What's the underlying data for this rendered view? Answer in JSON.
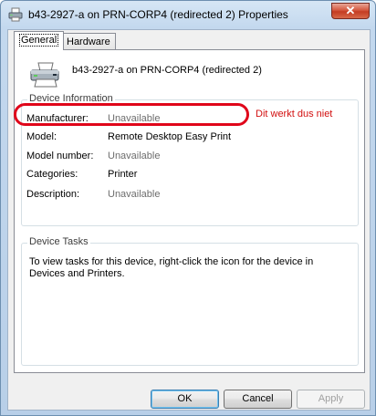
{
  "window": {
    "title": "b43-2927-a on PRN-CORP4 (redirected 2) Properties",
    "close_label": "✕"
  },
  "tabs": [
    {
      "label": "General",
      "active": true
    },
    {
      "label": "Hardware",
      "active": false
    }
  ],
  "device": {
    "name": "b43-2927-a on PRN-CORP4 (redirected 2)",
    "icon": "printer-icon"
  },
  "device_information": {
    "legend": "Device Information",
    "rows": [
      {
        "label": "Manufacturer:",
        "value": "Unavailable",
        "unavailable": true
      },
      {
        "label": "Model:",
        "value": "Remote Desktop Easy Print",
        "unavailable": false
      },
      {
        "label": "Model number:",
        "value": "Unavailable",
        "unavailable": true
      },
      {
        "label": "Categories:",
        "value": "Printer",
        "unavailable": false
      },
      {
        "label": "Description:",
        "value": "Unavailable",
        "unavailable": true
      }
    ]
  },
  "annotation": {
    "text": "Dit werkt dus niet",
    "color": "#d21010"
  },
  "device_tasks": {
    "legend": "Device Tasks",
    "text": "To view tasks for this device, right-click the icon for the device in Devices and Printers."
  },
  "buttons": {
    "ok": "OK",
    "cancel": "Cancel",
    "apply": "Apply"
  }
}
